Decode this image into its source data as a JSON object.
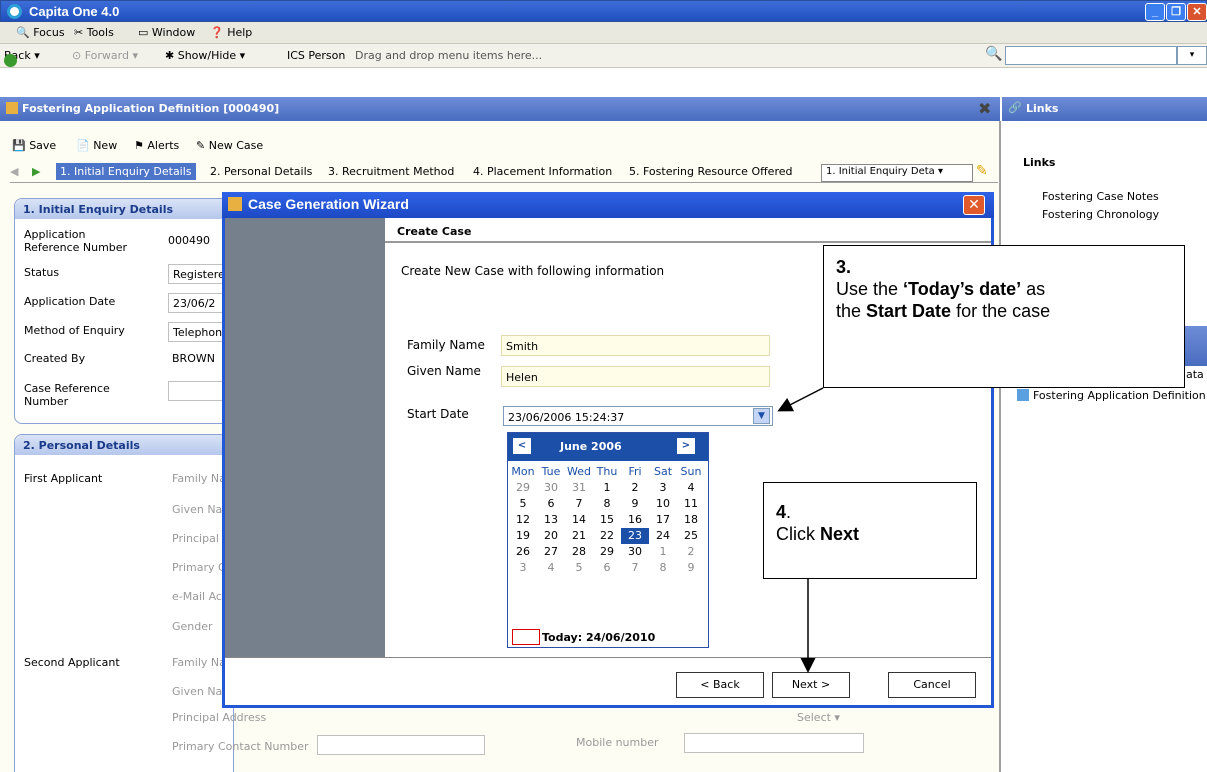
{
  "window": {
    "title": "Capita One 4.0"
  },
  "menu": {
    "focus": "Focus",
    "tools": "Tools",
    "window": "Window",
    "help": "Help"
  },
  "nav": {
    "back": "Back",
    "forward": "Forward",
    "showhide": "Show/Hide",
    "ics": "ICS Person",
    "hint": "Drag and drop menu items here..."
  },
  "panel": {
    "title": "Fostering Application Definition [000490]",
    "links_title": "Links"
  },
  "toolbar": {
    "save": "Save",
    "new": "New",
    "alerts": "Alerts",
    "newcase": "New Case"
  },
  "tabs": [
    "1. Initial Enquiry Details",
    "2. Personal Details",
    "3. Recruitment Method",
    "4. Placement Information",
    "5. Fostering Resource Offered"
  ],
  "tab_select": "1. Initial Enquiry Deta",
  "section1": {
    "title": "1. Initial Enquiry Details",
    "rows": [
      {
        "label": "Application Reference Number",
        "value": "000490"
      },
      {
        "label": "Status",
        "value": "Registere"
      },
      {
        "label": "Application Date",
        "value": "23/06/2"
      },
      {
        "label": "Method of Enquiry",
        "value": "Telephon"
      },
      {
        "label": "Created By",
        "value": "BROWN"
      },
      {
        "label": "Case Reference Number",
        "value": ""
      }
    ]
  },
  "section2": {
    "title": "2. Personal Details",
    "first": "First Applicant",
    "second": "Second Applicant",
    "first_fields": [
      "Family Na",
      "Given Na",
      "Principal",
      "Primary C",
      "e-Mail Ac",
      "Gender"
    ],
    "second_fields": [
      "Family Na",
      "Given Na",
      "Principal Address",
      "Primary Contact Number"
    ],
    "mobile": "Mobile number",
    "select": "Select"
  },
  "links": {
    "heading": "Links",
    "items": [
      "Fostering Case Notes",
      "Fostering Chronology"
    ],
    "partial": "ata",
    "definition": "Fostering Application Definition"
  },
  "dialog": {
    "title": "Case Generation Wizard",
    "header": "Create Case",
    "intro": "Create New Case with following information",
    "family_label": "Family Name",
    "family_value": "Smith",
    "given_label": "Given Name",
    "given_value": "Helen",
    "start_label": "Start Date",
    "start_value": "23/06/2006 15:24:37",
    "back": "< Back",
    "next": "Next >",
    "cancel": "Cancel"
  },
  "calendar": {
    "month": "June 2006",
    "prev": "<",
    "next": ">",
    "days": [
      "Mon",
      "Tue",
      "Wed",
      "Thu",
      "Fri",
      "Sat",
      "Sun"
    ],
    "weeks": [
      [
        "29",
        "30",
        "31",
        "1",
        "2",
        "3",
        "4"
      ],
      [
        "5",
        "6",
        "7",
        "8",
        "9",
        "10",
        "11"
      ],
      [
        "12",
        "13",
        "14",
        "15",
        "16",
        "17",
        "18"
      ],
      [
        "19",
        "20",
        "21",
        "22",
        "23",
        "24",
        "25"
      ],
      [
        "26",
        "27",
        "28",
        "29",
        "30",
        "1",
        "2"
      ],
      [
        "3",
        "4",
        "5",
        "6",
        "7",
        "8",
        "9"
      ]
    ],
    "selected": "23",
    "today": "Today: 24/06/2010"
  },
  "callout3": {
    "num": "3.",
    "l1a": "Use the ",
    "l1b": "‘Today’s date’",
    "l1c": " as",
    "l2a": "the ",
    "l2b": "Start Date",
    "l2c": " for the case"
  },
  "callout4": {
    "num": "4",
    "dot": ".",
    "l1a": "Click ",
    "l1b": "Next"
  }
}
